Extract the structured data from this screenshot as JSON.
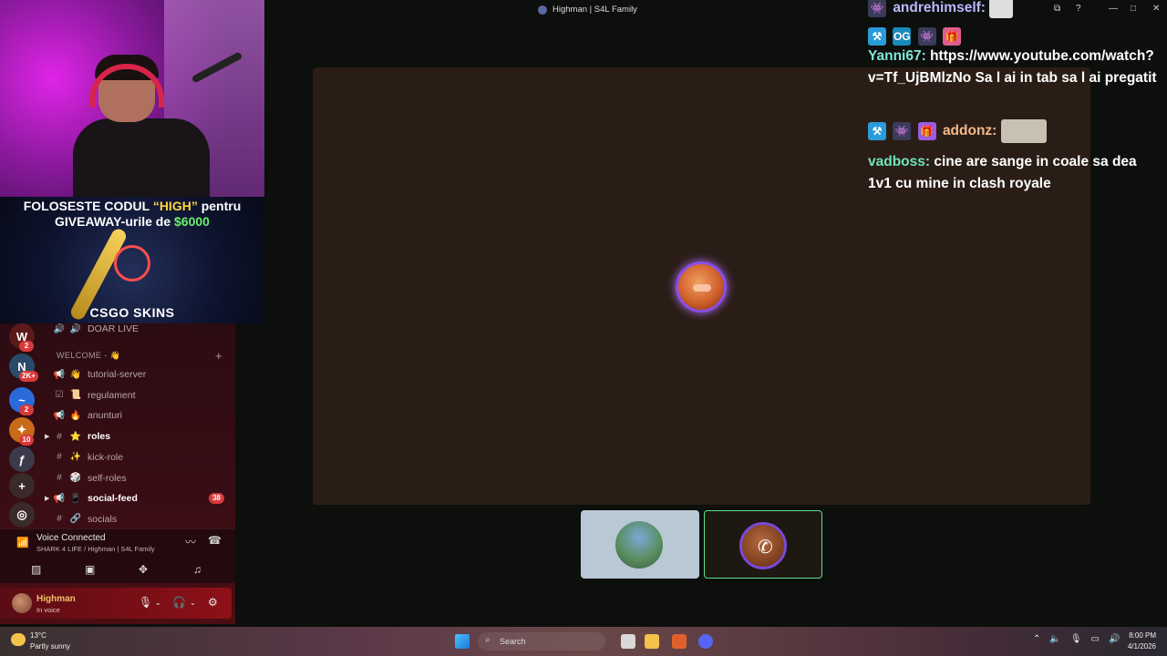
{
  "window": {
    "title": "Highman | S4L Family"
  },
  "webcam": {
    "promo_prefix": "FOLOSESTE CODUL ",
    "promo_code": "“HIGH”",
    "promo_suffix": " pentru",
    "promo_line2_prefix": "GIVEAWAY-urile de ",
    "promo_amount": "$6000",
    "brand": "CSGO SKINS"
  },
  "sidebar": {
    "guilds": [
      {
        "label": "W",
        "color": "#5a1a1a",
        "badge": "2"
      },
      {
        "label": "N",
        "color": "#2a4a6a",
        "badge": "2K+"
      },
      {
        "label": "~",
        "color": "#2a6ad8",
        "badge": "2"
      },
      {
        "label": "✦",
        "color": "#c86a1a",
        "badge": "10"
      },
      {
        "label": "ƒ",
        "color": "#3a3a4a",
        "badge": ""
      },
      {
        "label": "+",
        "color": "#3a2a2a",
        "badge": ""
      },
      {
        "label": "◎",
        "color": "#3a2a2a",
        "badge": ""
      }
    ],
    "top_channel": {
      "name": "DOAR LIVE",
      "icon": "speaker-icon",
      "emoji": "🔊"
    },
    "category": "WELCOME - 👋",
    "channels": [
      {
        "name": "tutorial-server",
        "icon": "📢",
        "emoji": "👋",
        "bold": false,
        "count": ""
      },
      {
        "name": "regulament",
        "icon": "☑",
        "emoji": "📜",
        "bold": false,
        "count": ""
      },
      {
        "name": "anunturi",
        "icon": "📢",
        "emoji": "🔥",
        "bold": false,
        "count": ""
      },
      {
        "name": "roles",
        "icon": "#",
        "emoji": "⭐",
        "bold": true,
        "count": ""
      },
      {
        "name": "kick-role",
        "icon": "#",
        "emoji": "✨",
        "bold": false,
        "count": ""
      },
      {
        "name": "self-roles",
        "icon": "#",
        "emoji": "🎲",
        "bold": false,
        "count": ""
      },
      {
        "name": "social-feed",
        "icon": "📢",
        "emoji": "📱",
        "bold": true,
        "count": "38"
      },
      {
        "name": "socials",
        "icon": "#",
        "emoji": "🔗",
        "bold": false,
        "count": ""
      }
    ],
    "voice": {
      "title": "Voice Connected",
      "subtitle": "SHARK 4 LIFE / Highman | S4L Family"
    },
    "user": {
      "name": "Highman",
      "status": "In voice"
    }
  },
  "chat": [
    {
      "user": "andrehimself:",
      "text": ""
    },
    {
      "user": "Yanni67:",
      "text": "https://www.youtube.com/watch?v=Tf_UjBMlzNo Sa l ai in tab sa l ai pregatit"
    },
    {
      "user": "addonz:",
      "text": ""
    },
    {
      "user": "vadboss:",
      "text": "cine are sange in coale sa dea 1v1 cu mine in clash royale"
    }
  ],
  "taskbar": {
    "temp": "13°C",
    "weather": "Partly sunny",
    "search": "Search",
    "time": "8:00 PM",
    "date": "4/1/2026"
  },
  "colors": {
    "accent_voice": "#5ae08c",
    "speaking_ring": "#8a4ee8",
    "badge_red": "#d83a3a"
  }
}
